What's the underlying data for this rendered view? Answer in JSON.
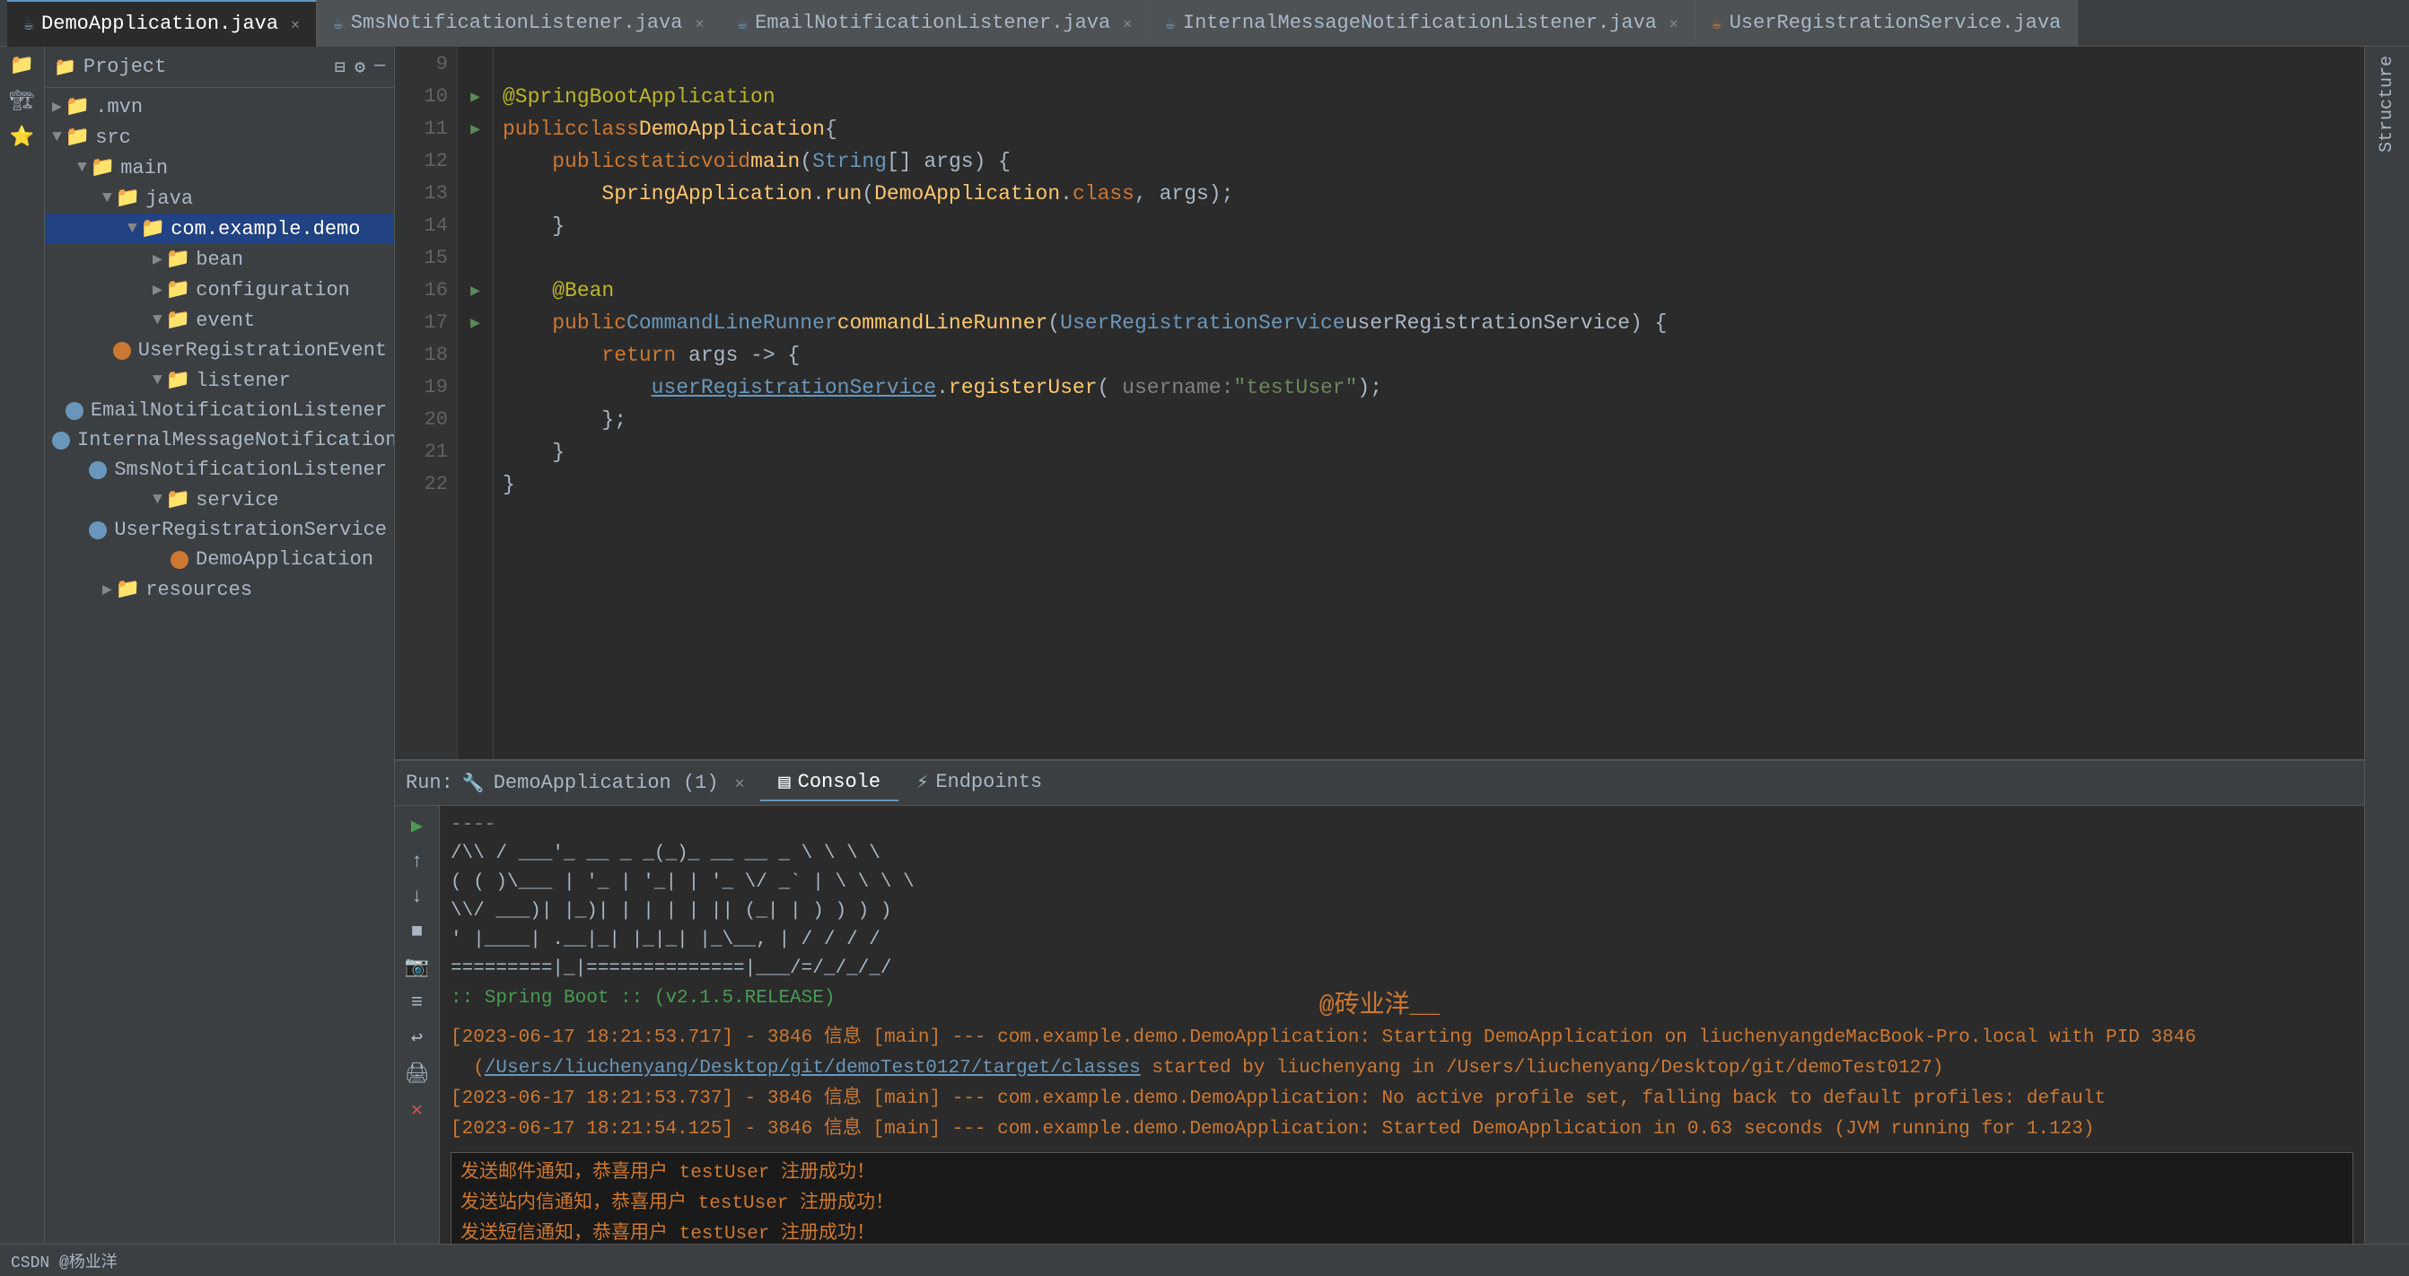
{
  "tabs": [
    {
      "label": "DemoApplication.java",
      "active": true,
      "icon": "java"
    },
    {
      "label": "SmsNotificationListener.java",
      "active": false,
      "icon": "java"
    },
    {
      "label": "EmailNotificationListener.java",
      "active": false,
      "icon": "java"
    },
    {
      "label": "InternalMessageNotificationListener.java",
      "active": false,
      "icon": "java"
    },
    {
      "label": "UserRegistrationService.java",
      "active": false,
      "icon": "java"
    }
  ],
  "sidebar": {
    "title": "Project",
    "tree": [
      {
        "level": 0,
        "type": "folder",
        "label": ".mvn",
        "expanded": false
      },
      {
        "level": 0,
        "type": "folder",
        "label": "src",
        "expanded": true
      },
      {
        "level": 1,
        "type": "folder",
        "label": "main",
        "expanded": true
      },
      {
        "level": 2,
        "type": "folder",
        "label": "java",
        "expanded": true
      },
      {
        "level": 3,
        "type": "folder",
        "label": "com.example.demo",
        "expanded": true,
        "selected": true
      },
      {
        "level": 4,
        "type": "folder",
        "label": "bean",
        "expanded": false
      },
      {
        "level": 4,
        "type": "folder",
        "label": "configuration",
        "expanded": false
      },
      {
        "level": 4,
        "type": "folder",
        "label": "event",
        "expanded": true
      },
      {
        "level": 5,
        "type": "file",
        "label": "UserRegistrationEvent",
        "icon": "orange"
      },
      {
        "level": 4,
        "type": "folder",
        "label": "listener",
        "expanded": true
      },
      {
        "level": 5,
        "type": "file",
        "label": "EmailNotificationListener"
      },
      {
        "level": 5,
        "type": "file",
        "label": "InternalMessageNotificationListener"
      },
      {
        "level": 5,
        "type": "file",
        "label": "SmsNotificationListener"
      },
      {
        "level": 4,
        "type": "folder",
        "label": "service",
        "expanded": true
      },
      {
        "level": 5,
        "type": "file",
        "label": "UserRegistrationService"
      },
      {
        "level": 3,
        "type": "file",
        "label": "DemoApplication",
        "icon": "orange"
      },
      {
        "level": 2,
        "type": "folder",
        "label": "resources",
        "expanded": false
      }
    ]
  },
  "editor": {
    "lines": [
      {
        "num": 9,
        "content": ""
      },
      {
        "num": 10,
        "content": "@SpringBootApplication",
        "type": "annotation"
      },
      {
        "num": 11,
        "content": "public class DemoApplication {"
      },
      {
        "num": 12,
        "content": "    public static void main(String[] args) {"
      },
      {
        "num": 13,
        "content": "        SpringApplication.run(DemoApplication.class, args);"
      },
      {
        "num": 14,
        "content": "    }"
      },
      {
        "num": 15,
        "content": ""
      },
      {
        "num": 16,
        "content": "    @Bean"
      },
      {
        "num": 17,
        "content": "    public CommandLineRunner commandLineRunner(UserRegistrationService userRegistrationService) {"
      },
      {
        "num": 18,
        "content": "        return args -> {"
      },
      {
        "num": 19,
        "content": "            userRegistrationService.registerUser( username: \"testUser\");"
      },
      {
        "num": 20,
        "content": "        };"
      },
      {
        "num": 21,
        "content": "    }"
      },
      {
        "num": 22,
        "content": "}"
      }
    ]
  },
  "run_panel": {
    "label": "Run:",
    "app_name": "DemoApplication (1)",
    "tabs": [
      {
        "label": "Console",
        "active": true,
        "icon": "console"
      },
      {
        "label": "Endpoints",
        "active": false,
        "icon": "endpoints"
      }
    ],
    "ascii_art": [
      "/\\\\  / ___'_ __ _ _(_)_ __  __ _ \\ \\ \\ \\",
      "( ( )\\___ | '_ | '_| | '_ \\/ _` | \\ \\ \\ \\",
      " \\\\/  ___)| |_)| | | | | || (_| |  ) ) ) )",
      "  '  |____| .__|_| |_|_| |_\\__, | / / / /",
      " =========|_|==============|___/=/_/_/_/"
    ],
    "spring_boot_line": "  :: Spring Boot ::        (v2.1.5.RELEASE)",
    "log_lines": [
      "[2023-06-17 18:21:53.717] - 3846 信息 [main] --- com.example.demo.DemoApplication: Starting DemoApplication on liuchenyangdeMacBook-Pro.local with PID 3846",
      "(/Users/liuchenyang/Desktop/git/demoTest0127/target/classes started by liuchenyang in /Users/liuchenyang/Desktop/git/demoTest0127)",
      "[2023-06-17 18:21:53.737] - 3846 信息 [main] --- com.example.demo.DemoApplication: No active profile set, falling back to default profiles: default",
      "[2023-06-17 18:21:54.125] - 3846 信息 [main] --- com.example.demo.DemoApplication: Started DemoApplication in 0.63 seconds (JVM running for 1.123)"
    ],
    "success_messages": [
      "发送邮件通知，恭喜用户 testUser 注册成功！",
      "发送站内信通知，恭喜用户 testUser 注册成功！",
      "发送短信通知，恭喜用户 testUser 注册成功！"
    ],
    "watermark": "@砖业洋__"
  },
  "status_bar": {
    "left": "CSDN @杨业洋",
    "right": ""
  }
}
